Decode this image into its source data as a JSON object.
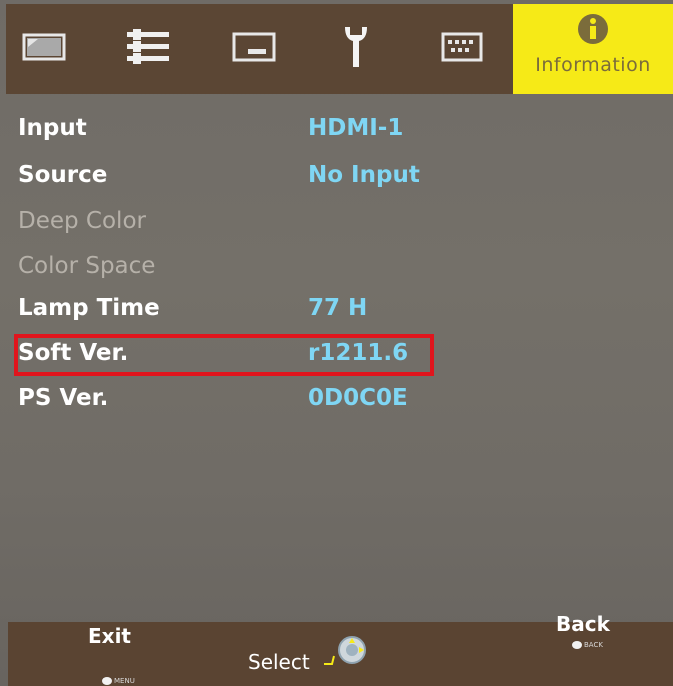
{
  "header": {
    "tabs": [
      {
        "icon": "picture-icon"
      },
      {
        "icon": "adjust-sliders-icon"
      },
      {
        "icon": "screen-icon"
      },
      {
        "icon": "wrench-icon"
      },
      {
        "icon": "keyboard-icon"
      },
      {
        "icon": "info-icon",
        "label": "Information",
        "active": true
      }
    ],
    "active_color": "#f6ea17",
    "bar_color": "#5b4634"
  },
  "info": {
    "rows": [
      {
        "label": "Input",
        "value": "HDMI-1"
      },
      {
        "label": "Source",
        "value": "No Input"
      },
      {
        "label": "Deep Color",
        "value": ""
      },
      {
        "label": "Color Space",
        "value": ""
      },
      {
        "label": "Lamp Time",
        "value": "77 H"
      },
      {
        "label": "Soft Ver.",
        "value": "r1211.6"
      },
      {
        "label": "PS Ver.",
        "value": "0D0C0E"
      }
    ],
    "highlight_color": "#e0151d"
  },
  "footer": {
    "exit_label": "Exit",
    "exit_key": "MENU",
    "select_label": "Select",
    "back_label": "Back",
    "back_key": "BACK"
  }
}
